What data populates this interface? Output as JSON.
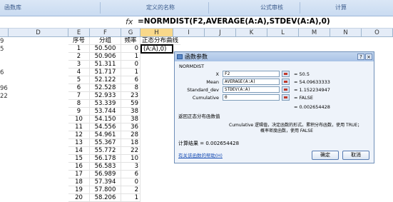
{
  "ribbon": {
    "groups": [
      "函数库",
      "定义的名称",
      "公式审核",
      "计算"
    ]
  },
  "formula_bar": {
    "fx": "fx",
    "formula": "=NORMDIST(F2,AVERAGE(A:A),STDEV(A:A),0)"
  },
  "columns": [
    "D",
    "E",
    "F",
    "G",
    "H",
    "I",
    "J",
    "K",
    "L",
    "M",
    "N",
    "O"
  ],
  "left_edge": [
    "9",
    "5",
    "",
    "",
    "6",
    "",
    "96",
    "22"
  ],
  "headers": {
    "e": "序号",
    "f": "分组",
    "g": "频率",
    "h": "正态分布曲线"
  },
  "active_cell": "(A:A),0)",
  "rows": [
    {
      "e": "1",
      "f": "50.500",
      "g": "0"
    },
    {
      "e": "2",
      "f": "50.906",
      "g": "1"
    },
    {
      "e": "3",
      "f": "51.311",
      "g": "0"
    },
    {
      "e": "4",
      "f": "51.717",
      "g": "1"
    },
    {
      "e": "5",
      "f": "52.122",
      "g": "6"
    },
    {
      "e": "6",
      "f": "52.528",
      "g": "8"
    },
    {
      "e": "7",
      "f": "52.933",
      "g": "23"
    },
    {
      "e": "8",
      "f": "53.339",
      "g": "59"
    },
    {
      "e": "9",
      "f": "53.744",
      "g": "38"
    },
    {
      "e": "10",
      "f": "54.150",
      "g": "38"
    },
    {
      "e": "11",
      "f": "54.556",
      "g": "36"
    },
    {
      "e": "12",
      "f": "54.961",
      "g": "28"
    },
    {
      "e": "13",
      "f": "55.367",
      "g": "18"
    },
    {
      "e": "14",
      "f": "55.772",
      "g": "22"
    },
    {
      "e": "15",
      "f": "56.178",
      "g": "10"
    },
    {
      "e": "16",
      "f": "56.583",
      "g": "3"
    },
    {
      "e": "17",
      "f": "56.989",
      "g": "6"
    },
    {
      "e": "18",
      "f": "57.394",
      "g": "0"
    },
    {
      "e": "19",
      "f": "57.800",
      "g": "2"
    },
    {
      "e": "20",
      "f": "58.206",
      "g": "1"
    }
  ],
  "dialog": {
    "title": "函数参数",
    "function_name": "NORMDIST",
    "params": [
      {
        "label": "X",
        "value": "F2",
        "result": "= 50.5"
      },
      {
        "label": "Mean",
        "value": "AVERAGE(A:A)",
        "result": "= 54.09633333"
      },
      {
        "label": "Standard_dev",
        "value": "STDEV(A:A)",
        "result": "= 1.152234947"
      },
      {
        "label": "Cumulative",
        "value": "0",
        "result": "= FALSE"
      }
    ],
    "total_result": "= 0.002654428",
    "description": "返回正态分布函数值",
    "cumulative_help_1": "Cumulative  逻辑值，决定函数的形式。累积分布函数，使用 TRUE；",
    "cumulative_help_2": "概率密度函数，使用 FALSE",
    "calc_result": "计算结果 = 0.002654428",
    "help_link": "有关该函数的帮助(H)",
    "ok": "确定",
    "cancel": "取消",
    "help_btn": "?",
    "close_btn": "×"
  }
}
